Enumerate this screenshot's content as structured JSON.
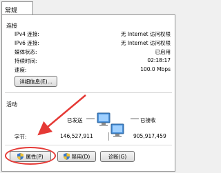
{
  "tab": "常规",
  "connection": {
    "title": "连接",
    "rows": [
      {
        "label": "IPv4 连接:",
        "value": "无 Internet 访问权限"
      },
      {
        "label": "IPv6 连接:",
        "value": "无 Internet 访问权限"
      },
      {
        "label": "媒体状态:",
        "value": "已启用"
      },
      {
        "label": "持续时间:",
        "value": "02:18:17"
      },
      {
        "label": "速度:",
        "value": "100.0 Mbps"
      }
    ],
    "details_button": "详细信息(E)..."
  },
  "activity": {
    "title": "活动",
    "sent_label": "已发送",
    "received_label": "已接收",
    "bytes_label": "字节:",
    "bytes_sent": "146,527,911",
    "bytes_received": "905,917,459"
  },
  "buttons": {
    "properties": "属性(P)",
    "disable": "禁用(D)",
    "diagnose": "诊断(G)"
  },
  "colors": {
    "annotation": "#e53935",
    "shield_blue": "#3a78c9",
    "shield_yellow": "#f2c230"
  }
}
